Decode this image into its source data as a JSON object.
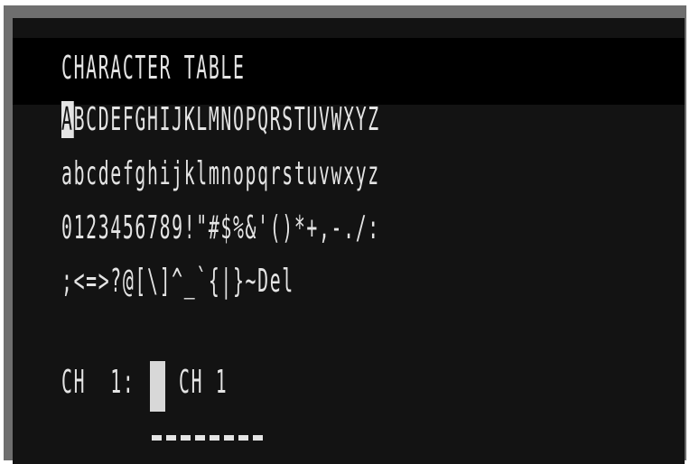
{
  "screen": {
    "title": "CHARACTER TABLE",
    "rows": {
      "uppercase_first": "A",
      "uppercase_rest": "BCDEFGHIJKLMNOPQRSTUVWXYZ",
      "lowercase": "abcdefghijklmnopqrstuvwxyz",
      "digits_symbols": "0123456789!\"#$%&'()*+,-./:",
      "symbols": ";<=>?@[\\]^_`{|}~Del"
    },
    "channel_left": "CH  1:",
    "channel_right": "CH 1"
  },
  "colors": {
    "screen_background": "#131313",
    "title_bar": "#000000",
    "text": "#e4e4e4",
    "bezel": "#6f6f6f"
  }
}
